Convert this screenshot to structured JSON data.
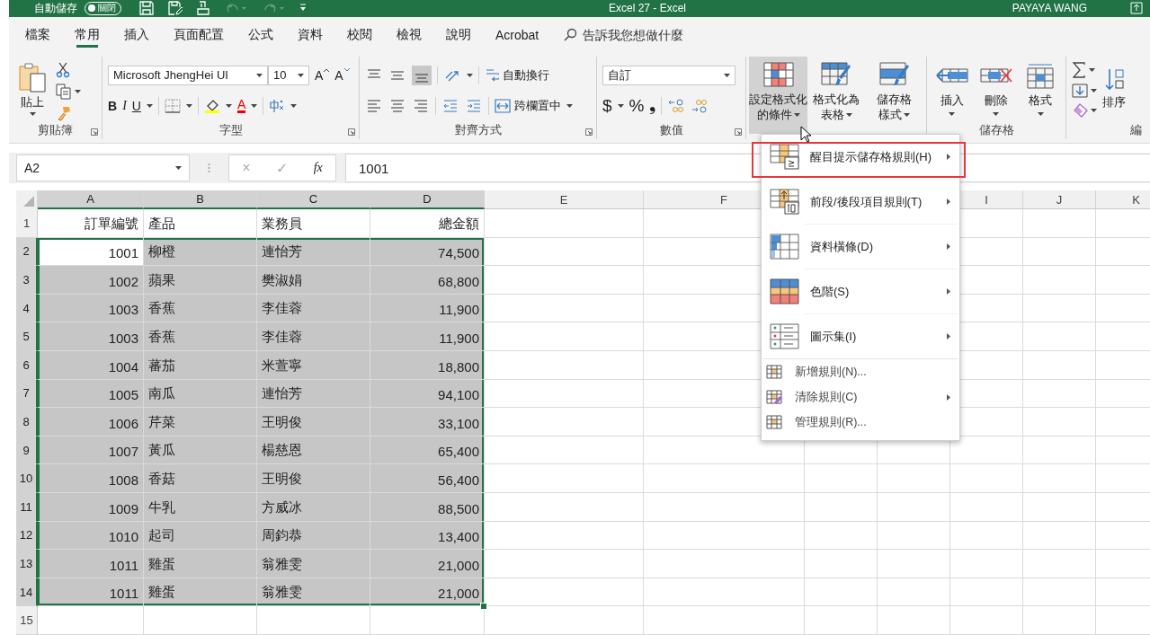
{
  "title_bar": {
    "autosave_label": "自動儲存",
    "autosave_toggle": "關閉",
    "autosave_on": false,
    "document_title": "Excel 27  -  Excel",
    "user": "PAYAYA WANG"
  },
  "ribbon_tabs": [
    {
      "label": "檔案",
      "selected": false
    },
    {
      "label": "常用",
      "selected": true
    },
    {
      "label": "插入",
      "selected": false
    },
    {
      "label": "頁面配置",
      "selected": false
    },
    {
      "label": "公式",
      "selected": false
    },
    {
      "label": "資料",
      "selected": false
    },
    {
      "label": "校閱",
      "selected": false
    },
    {
      "label": "檢視",
      "selected": false
    },
    {
      "label": "說明",
      "selected": false
    },
    {
      "label": "Acrobat",
      "selected": false
    }
  ],
  "tell_me": {
    "placeholder": "告訴我您想做什麼"
  },
  "ribbon": {
    "clipboard": {
      "paste": "貼上",
      "label": "剪貼簿"
    },
    "font": {
      "name": "Microsoft JhengHei UI",
      "size": "10",
      "grow": "A",
      "shrink": "A",
      "bold": "B",
      "italic": "I",
      "underline": "U",
      "font_color": "A",
      "label": "字型"
    },
    "alignment": {
      "wrap": "自動換行",
      "merge": "跨欄置中",
      "label": "對齊方式"
    },
    "number": {
      "format": "自訂",
      "currency": "$",
      "percent": "%",
      "comma": "❟",
      "label": "數值"
    },
    "styles": [
      {
        "kind": "conditional",
        "lines": [
          "設定格式化",
          "的條件"
        ],
        "pressed": true
      },
      {
        "kind": "table",
        "lines": [
          "格式化為",
          "表格"
        ],
        "pressed": false
      },
      {
        "kind": "cellstyle",
        "lines": [
          "儲存格",
          "樣式"
        ],
        "pressed": false
      }
    ],
    "cells": {
      "buttons": [
        {
          "kind": "insert",
          "label": "插入"
        },
        {
          "kind": "delete",
          "label": "刪除"
        },
        {
          "kind": "format",
          "label": "格式"
        }
      ],
      "label": "儲存格"
    },
    "editing": {
      "sort": "排序",
      "label": "編"
    }
  },
  "formula_bar": {
    "name_box": "A2",
    "cancel": "×",
    "enter": "✓",
    "fx": "fx",
    "value": "1001"
  },
  "columns": [
    {
      "label": "A",
      "selected": true
    },
    {
      "label": "B",
      "selected": true
    },
    {
      "label": "C",
      "selected": true
    },
    {
      "label": "D",
      "selected": true
    },
    {
      "label": "E",
      "selected": false
    },
    {
      "label": "F",
      "selected": false
    },
    {
      "label": "I",
      "selected": false
    },
    {
      "label": "J",
      "selected": false
    },
    {
      "label": "K",
      "selected": false
    }
  ],
  "rows": [
    {
      "number": "1",
      "cells": [
        "訂單編號",
        "產品",
        "業務員",
        "總金額"
      ],
      "selected": false,
      "active": false
    },
    {
      "number": "2",
      "cells": [
        "1001",
        "柳橙",
        "連怡芳",
        "74,500"
      ],
      "selected": true,
      "active": true
    },
    {
      "number": "3",
      "cells": [
        "1002",
        "蘋果",
        "樊淑娟",
        "68,800"
      ],
      "selected": true,
      "active": false
    },
    {
      "number": "4",
      "cells": [
        "1003",
        "香蕉",
        "李佳蓉",
        "11,900"
      ],
      "selected": true,
      "active": false
    },
    {
      "number": "5",
      "cells": [
        "1003",
        "香蕉",
        "李佳蓉",
        "11,900"
      ],
      "selected": true,
      "active": false
    },
    {
      "number": "6",
      "cells": [
        "1004",
        "蕃茄",
        "米萱寧",
        "18,800"
      ],
      "selected": true,
      "active": false
    },
    {
      "number": "7",
      "cells": [
        "1005",
        "南瓜",
        "連怡芳",
        "94,100"
      ],
      "selected": true,
      "active": false
    },
    {
      "number": "8",
      "cells": [
        "1006",
        "芹菜",
        "王明俊",
        "33,100"
      ],
      "selected": true,
      "active": false
    },
    {
      "number": "9",
      "cells": [
        "1007",
        "黃瓜",
        "楊慈恩",
        "65,400"
      ],
      "selected": true,
      "active": false
    },
    {
      "number": "10",
      "cells": [
        "1008",
        "香菇",
        "王明俊",
        "56,400"
      ],
      "selected": true,
      "active": false
    },
    {
      "number": "11",
      "cells": [
        "1009",
        "牛乳",
        "方威冰",
        "88,500"
      ],
      "selected": true,
      "active": false
    },
    {
      "number": "12",
      "cells": [
        "1010",
        "起司",
        "周鈞恭",
        "13,400"
      ],
      "selected": true,
      "active": false
    },
    {
      "number": "13",
      "cells": [
        "1011",
        "雞蛋",
        "翁雅雯",
        "21,000"
      ],
      "selected": true,
      "active": false
    },
    {
      "number": "14",
      "cells": [
        "1011",
        "雞蛋",
        "翁雅雯",
        "21,000"
      ],
      "selected": true,
      "active": false
    },
    {
      "number": "15",
      "selected": false,
      "active": false
    }
  ],
  "dropdown_menu": [
    {
      "kind": "highlight",
      "label": "醒目提示儲存格規則(H)",
      "submenu": true,
      "highlighted": true
    },
    {
      "kind": "topbottom",
      "label": "前段/後段項目規則(T)",
      "submenu": true,
      "highlighted": false
    },
    {
      "kind": "databars",
      "label": "資料橫條(D)",
      "submenu": true,
      "highlighted": false
    },
    {
      "kind": "colorscales",
      "label": "色階(S)",
      "submenu": true,
      "highlighted": false
    },
    {
      "kind": "iconsets",
      "label": "圖示集(I)",
      "submenu": true,
      "highlighted": false
    },
    {
      "kind": "newrule",
      "label": "新增規則(N)...",
      "submenu": false,
      "highlighted": false
    },
    {
      "kind": "clearrules",
      "label": "清除規則(C)",
      "submenu": true,
      "highlighted": false
    },
    {
      "kind": "managerules",
      "label": "管理規則(R)...",
      "submenu": false,
      "highlighted": false
    }
  ]
}
